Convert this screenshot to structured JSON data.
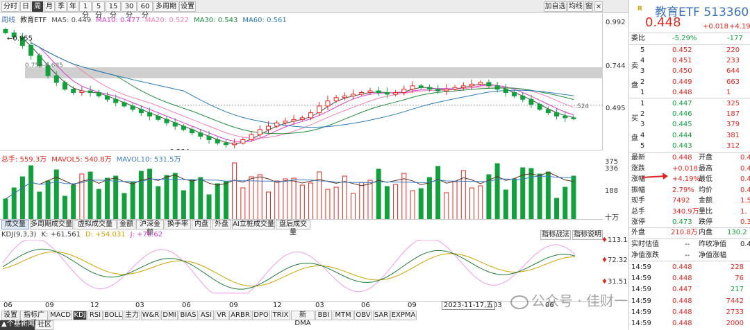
{
  "toolbar": {
    "left": [
      "分时",
      "日",
      "周",
      "月",
      "季",
      "年",
      "1分",
      "5分",
      "15分",
      "30分",
      "60分",
      "多周期",
      "设置"
    ],
    "selected": "周",
    "right": [
      "加自选",
      "均线",
      "窗"
    ]
  },
  "main_legend": {
    "period": "周线",
    "name": "教育ETF",
    "items": [
      {
        "label": "MA5: 0.449",
        "color": "#4a4a4a"
      },
      {
        "label": "MA10: 0.477",
        "color": "#d63bd6"
      },
      {
        "label": "MA20: 0.522",
        "color": "#f07fb0"
      },
      {
        "label": "MA30: 0.543",
        "color": "#1f8a3b"
      },
      {
        "label": "MA60: 0.561",
        "color": "#2a7bb5"
      }
    ]
  },
  "price_axis": [
    "0.992",
    "0.744",
    "0.495"
  ],
  "price_annotations": {
    "high": "0.955",
    "low": "0.284",
    "band": "0.750-0.685",
    "right": ".524"
  },
  "vol_legend": {
    "items": [
      {
        "label": "总手: 559.3万",
        "color": "#e0261e"
      },
      {
        "label": "MAVOL5: 540.8万",
        "color": "#e0261e"
      },
      {
        "label": "MAVOL10: 531.5万",
        "color": "#3b7bbf"
      }
    ]
  },
  "vol_axis": [
    "375",
    "336",
    "188",
    "十万"
  ],
  "indicator_tabs": [
    "成交量",
    "多周期成交量",
    "虚拟成交量",
    "金额",
    "沪深金额",
    "换手率",
    "内盘",
    "外盘",
    "AI立桩成交量",
    "盘后成交量"
  ],
  "indicator_selected": "成交量",
  "side_buttons": [
    "指标战法",
    "指标说明"
  ],
  "kdj_legend": [
    {
      "label": "KDJ(9,3,3)",
      "color": "#333"
    },
    {
      "label": "K: +61.561",
      "color": "#333"
    },
    {
      "label": "D: +54.031",
      "color": "#c9a300"
    },
    {
      "label": "J: +76.62",
      "color": "#d63bd6"
    }
  ],
  "kdj_axis": [
    "113.1",
    "72.32",
    "31.51"
  ],
  "x_axis": [
    "06",
    "09",
    "12",
    "03",
    "06",
    "09",
    "12",
    "03",
    "06",
    "09",
    "03",
    "06"
  ],
  "cursor_date": "2023-11-17,五",
  "bottom_tabs": [
    "设置",
    "指标广场",
    "MACD",
    "KDJ",
    "RSI",
    "BOLL",
    "主力",
    "W&R",
    "DMI",
    "BIAS",
    "ASI",
    "VR",
    "ARBR",
    "DPO",
    "TRIX",
    "新DMA",
    "BBI",
    "MTM",
    "OBV",
    "SAR",
    "EXPMA"
  ],
  "bottom_selected": "KDJ",
  "bottom_left": [
    "个基新闻",
    "社区"
  ],
  "watermark": "公众号 · 佳财一分钟",
  "quote": {
    "badge": "R",
    "name": "教育ETF",
    "code": "513360",
    "price": "0.448",
    "change": "+0.018",
    "pct": "+4.19",
    "weibi_label": "委比",
    "weibi": "-5.29%",
    "weicha": "-177",
    "sell_label": "卖盘",
    "buy_label": "买盘",
    "sell": [
      [
        "5",
        "0.452",
        "220"
      ],
      [
        "4",
        "0.451",
        "233"
      ],
      [
        "3",
        "0.450",
        "644"
      ],
      [
        "2",
        "0.449",
        "663"
      ],
      [
        "1",
        "0.448",
        "1"
      ]
    ],
    "buy": [
      [
        "1",
        "0.447",
        "325"
      ],
      [
        "2",
        "0.446",
        "187"
      ],
      [
        "3",
        "0.445",
        "379"
      ],
      [
        "4",
        "0.444",
        "381"
      ],
      [
        "5",
        "0.443",
        "312"
      ]
    ],
    "stats": [
      [
        "最新",
        "0.448",
        "开盘",
        "0.4"
      ],
      [
        "涨跌",
        "+0.018",
        "最高",
        "0.4"
      ],
      [
        "涨幅",
        "+4.19%",
        "最低",
        "0.4"
      ],
      [
        "振幅",
        "2.79%",
        "均价",
        "0.4"
      ],
      [
        "现手",
        "7492",
        "金额",
        "1.51"
      ],
      [
        "总手",
        "340.9万",
        "量比",
        "1."
      ],
      [
        "涨停",
        "0.473",
        "跌停",
        "0.3"
      ]
    ],
    "outer": [
      "外盘",
      "210.8万",
      "内盘",
      "130.2"
    ],
    "nav": [
      [
        "实时估值",
        "--",
        "昨收净值",
        "0.4"
      ],
      [
        "净值涨跌",
        "--",
        "净值涨幅",
        ""
      ]
    ],
    "ticks": [
      [
        "14:59",
        "0.448",
        "228"
      ],
      [
        "14:59",
        "0.448",
        "76"
      ],
      [
        "14:59",
        "0.447",
        "217"
      ],
      [
        "14:59",
        "0.448",
        "7442"
      ],
      [
        "14:59",
        "0.448",
        "2733"
      ],
      [
        "14:59",
        "0.448",
        "2000"
      ]
    ]
  },
  "chart_data": {
    "type": "candlestick",
    "title": "教育ETF 周线",
    "ylim": [
      0.28,
      1.0
    ],
    "x_ticks": [
      "06",
      "09",
      "12",
      "03",
      "06",
      "09",
      "12",
      "03",
      "06",
      "09",
      "03",
      "06"
    ],
    "series": [
      {
        "name": "price",
        "values": [
          0.955,
          0.93,
          0.88,
          0.82,
          0.76,
          0.7,
          0.66,
          0.62,
          0.6,
          0.61,
          0.6,
          0.58,
          0.56,
          0.54,
          0.52,
          0.5,
          0.48,
          0.46,
          0.44,
          0.42,
          0.4,
          0.38,
          0.36,
          0.34,
          0.32,
          0.3,
          0.29,
          0.3,
          0.32,
          0.35,
          0.38,
          0.4,
          0.42,
          0.43,
          0.44,
          0.45,
          0.48,
          0.52,
          0.55,
          0.57,
          0.58,
          0.59,
          0.6,
          0.61,
          0.6,
          0.59,
          0.6,
          0.62,
          0.64,
          0.63,
          0.62,
          0.61,
          0.62,
          0.63,
          0.64,
          0.65,
          0.66,
          0.64,
          0.62,
          0.6,
          0.58,
          0.56,
          0.53,
          0.5,
          0.48,
          0.46,
          0.45,
          0.448
        ]
      }
    ],
    "volume": {
      "name": "总手",
      "unit": "万",
      "last": 559.3,
      "mavol5": 540.8,
      "mavol10": 531.5
    },
    "kdj": {
      "K": 61.561,
      "D": 54.031,
      "J": 76.62
    }
  }
}
